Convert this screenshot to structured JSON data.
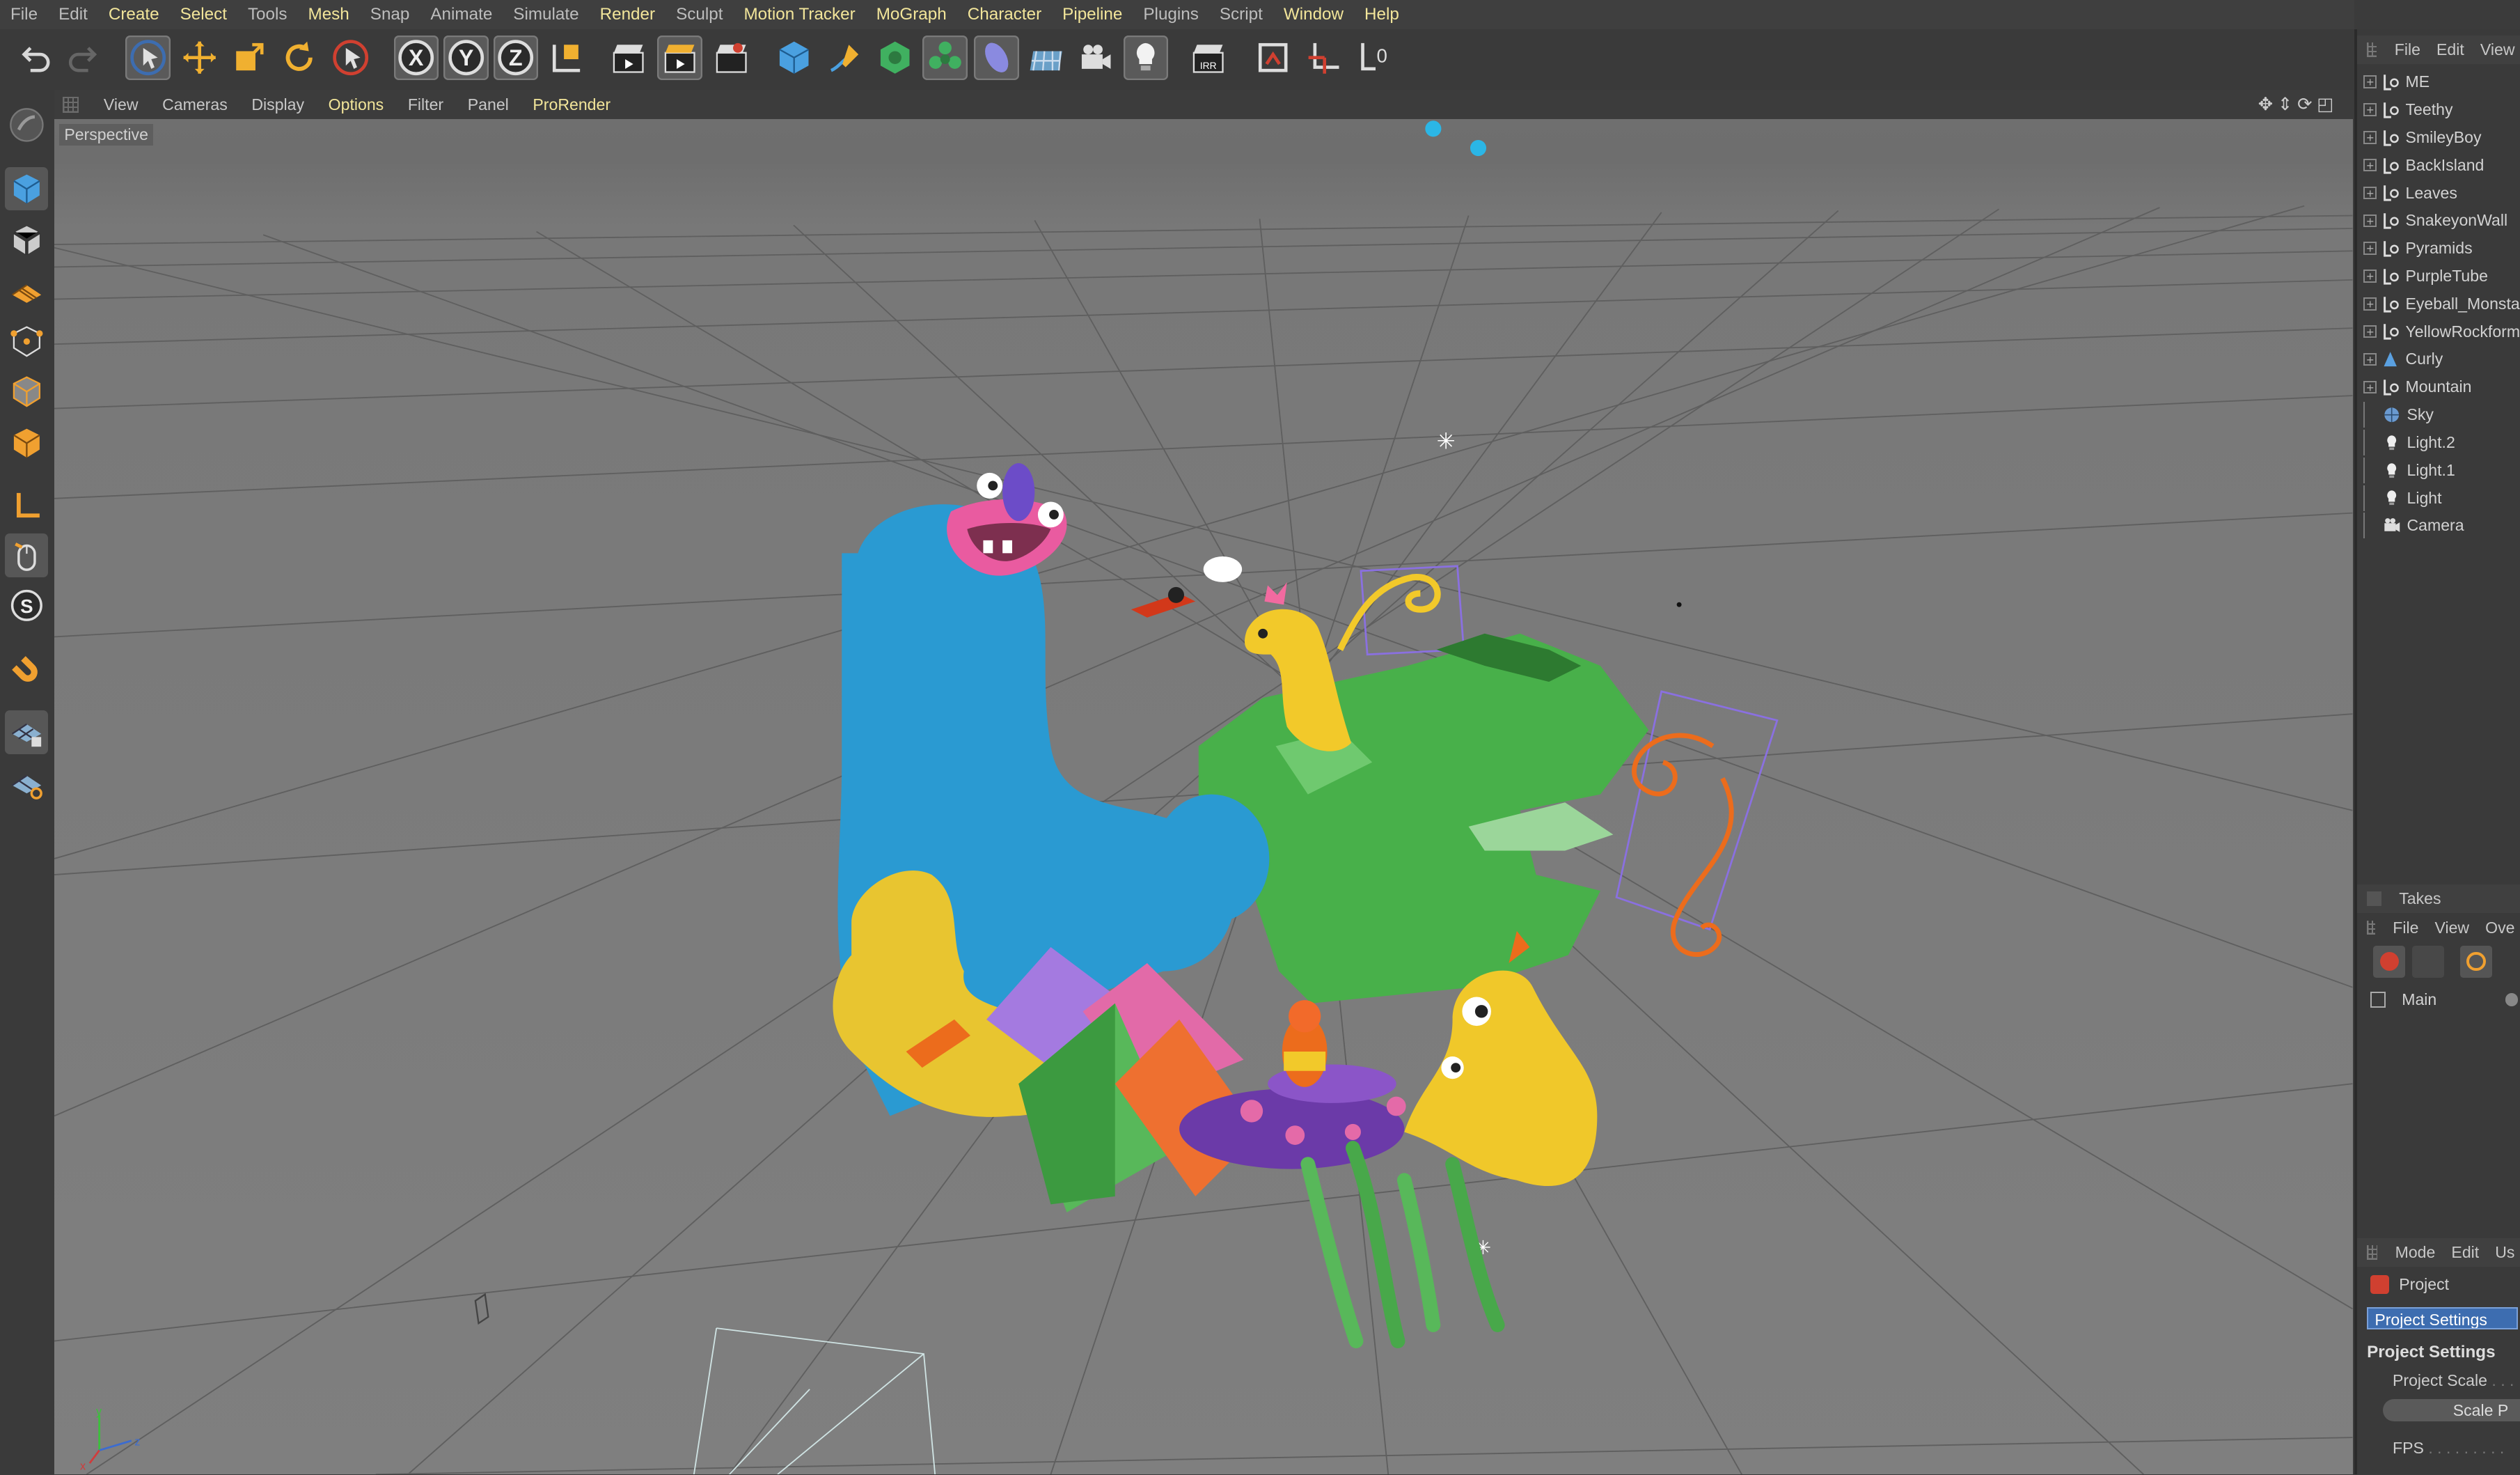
{
  "menubar": {
    "items": [
      {
        "label": "File",
        "hl": false
      },
      {
        "label": "Edit",
        "hl": false
      },
      {
        "label": "Create",
        "hl": true
      },
      {
        "label": "Select",
        "hl": true
      },
      {
        "label": "Tools",
        "hl": false
      },
      {
        "label": "Mesh",
        "hl": true
      },
      {
        "label": "Snap",
        "hl": false
      },
      {
        "label": "Animate",
        "hl": false
      },
      {
        "label": "Simulate",
        "hl": false
      },
      {
        "label": "Render",
        "hl": true
      },
      {
        "label": "Sculpt",
        "hl": false
      },
      {
        "label": "Motion Tracker",
        "hl": true
      },
      {
        "label": "MoGraph",
        "hl": true
      },
      {
        "label": "Character",
        "hl": true
      },
      {
        "label": "Pipeline",
        "hl": true
      },
      {
        "label": "Plugins",
        "hl": false
      },
      {
        "label": "Script",
        "hl": false
      },
      {
        "label": "Window",
        "hl": true
      },
      {
        "label": "Help",
        "hl": true
      }
    ]
  },
  "viewport_menu": {
    "items": [
      {
        "label": "View",
        "hl": false
      },
      {
        "label": "Cameras",
        "hl": false
      },
      {
        "label": "Display",
        "hl": false
      },
      {
        "label": "Options",
        "hl": true
      },
      {
        "label": "Filter",
        "hl": false
      },
      {
        "label": "Panel",
        "hl": false
      },
      {
        "label": "ProRender",
        "hl": true
      }
    ],
    "view_name": "Perspective"
  },
  "toolbar": {
    "axis_x": "X",
    "axis_y": "Y",
    "axis_z": "Z",
    "render_ipr": "IRR",
    "layer_icon": "0"
  },
  "object_manager": {
    "menu": [
      "File",
      "Edit",
      "View"
    ],
    "objects": [
      {
        "name": "ME",
        "icon": "null-icon",
        "expandable": true
      },
      {
        "name": "Teethy",
        "icon": "null-icon",
        "expandable": true
      },
      {
        "name": "SmileyBoy",
        "icon": "null-icon",
        "expandable": true
      },
      {
        "name": "BackIsland",
        "icon": "null-icon",
        "expandable": true
      },
      {
        "name": "Leaves",
        "icon": "null-icon",
        "expandable": true
      },
      {
        "name": "SnakeyonWall",
        "icon": "null-icon",
        "expandable": true
      },
      {
        "name": "Pyramids",
        "icon": "null-icon",
        "expandable": true
      },
      {
        "name": "PurpleTube",
        "icon": "null-icon",
        "expandable": true
      },
      {
        "name": "Eyeball_Monsta",
        "icon": "null-icon",
        "expandable": true
      },
      {
        "name": "YellowRockform",
        "icon": "null-icon",
        "expandable": true
      },
      {
        "name": "Curly",
        "icon": "joint-icon",
        "expandable": true
      },
      {
        "name": "Mountain",
        "icon": "null-icon",
        "expandable": true
      },
      {
        "name": "Sky",
        "icon": "sky-icon",
        "expandable": false
      },
      {
        "name": "Light.2",
        "icon": "light-icon",
        "expandable": false
      },
      {
        "name": "Light.1",
        "icon": "light-icon",
        "expandable": false
      },
      {
        "name": "Light",
        "icon": "light-icon",
        "expandable": false
      },
      {
        "name": "Camera",
        "icon": "camera-icon",
        "expandable": false
      }
    ]
  },
  "takes": {
    "title": "Takes",
    "menu": [
      "File",
      "View",
      "Ove"
    ],
    "main_take": "Main"
  },
  "attributes": {
    "menu": [
      "Mode",
      "Edit",
      "Us"
    ],
    "object": "Project",
    "tab": "Project Settings",
    "section": "Project Settings",
    "field_project_scale": "Project Scale",
    "button_scale": "Scale P",
    "field_fps": "FPS"
  },
  "colors": {
    "accent_yellow": "#f2e59a",
    "selection_blue": "#3d6db0"
  }
}
